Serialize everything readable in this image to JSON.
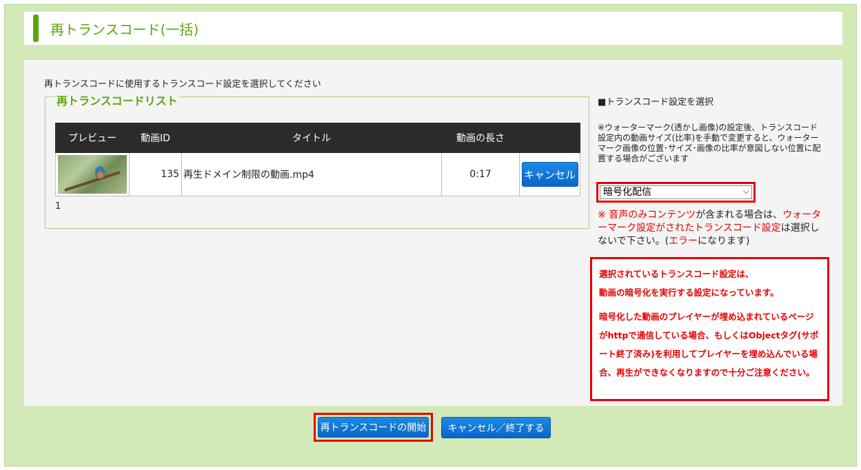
{
  "header": {
    "title": "再トランスコード(一括)"
  },
  "instruction": "再トランスコードに使用するトランスコード設定を選択してください",
  "list": {
    "legend": "再トランスコードリスト",
    "columns": [
      "プレビュー",
      "動画ID",
      "タイトル",
      "動画の長さ",
      ""
    ],
    "rows": [
      {
        "video_id": "135",
        "title": "再生ドメイン制限の動画.mp4",
        "duration": "0:17",
        "cancel_label": "キャンセル"
      }
    ],
    "pager": "1"
  },
  "settings": {
    "heading": "■トランスコード設定を選択",
    "note": "※ウォーターマーク(透かし画像)の設定後、トランスコード設定内の動画サイズ(比率)を手動で変更すると、ウォーターマーク画像の位置･サイズ･画像の比率が意図しない位置に配置する場合がございます",
    "selected": "暗号化配信",
    "audio_note": {
      "p1": "※ 音声のみコンテンツ",
      "p2": "が含まれる場合は、",
      "p3": "ウォーターマーク設定がされたトランスコード設定",
      "p4": "は選択しないで下さい。(",
      "p5": "エラー",
      "p6": "になります)"
    },
    "warning": {
      "line1": "選択されているトランスコード設定は、",
      "line2": "動画の暗号化を実行する設定になっています。",
      "line3": "暗号化した動画のプレイヤーが埋め込まれているページがhttpで通信している場合、もしくはObjectタグ(サポート終了済み)を利用してプレイヤーを埋め込んでいる場合、再生ができなくなりますので十分ご注意ください。"
    }
  },
  "actions": {
    "start_label": "再トランスコードの開始",
    "end_label": "キャンセル／終了する"
  },
  "colors": {
    "accent": "#5aa60f",
    "danger": "#e60000",
    "button": "#0a66c8"
  }
}
